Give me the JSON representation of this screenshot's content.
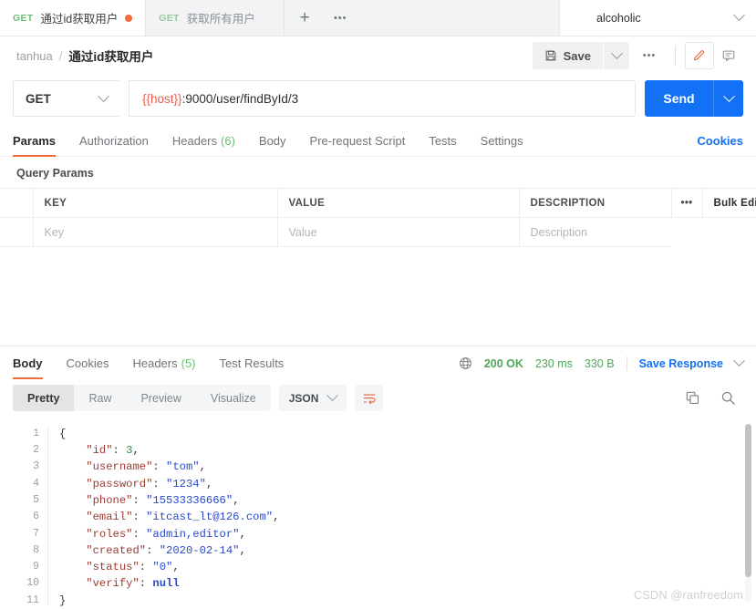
{
  "tabstrip": {
    "tabs": [
      {
        "method": "GET",
        "title": "通过id获取用户",
        "unsaved": true,
        "active": true
      },
      {
        "method": "GET",
        "title": "获取所有用户",
        "unsaved": false,
        "active": false
      }
    ],
    "new_tab_label": "+",
    "more_label": "•••",
    "environment": "alcoholic"
  },
  "header": {
    "breadcrumb_collection": "tanhua",
    "breadcrumb_separator": "/",
    "breadcrumb_request": "通过id获取用户",
    "save_label": "Save",
    "more_label": "•••"
  },
  "request": {
    "method": "GET",
    "url_variable": "{{host}}",
    "url_rest": ":9000/user/findById/3",
    "send_label": "Send",
    "tabs": [
      {
        "label": "Params",
        "count": "",
        "active": true
      },
      {
        "label": "Authorization",
        "count": "",
        "active": false
      },
      {
        "label": "Headers",
        "count": "(6)",
        "active": false
      },
      {
        "label": "Body",
        "count": "",
        "active": false
      },
      {
        "label": "Pre-request Script",
        "count": "",
        "active": false
      },
      {
        "label": "Tests",
        "count": "",
        "active": false
      },
      {
        "label": "Settings",
        "count": "",
        "active": false
      }
    ],
    "cookies_label": "Cookies"
  },
  "query_params": {
    "section_label": "Query Params",
    "columns": [
      "KEY",
      "VALUE",
      "DESCRIPTION"
    ],
    "dots_label": "•••",
    "bulk_edit_label": "Bulk Edit",
    "placeholder_row": {
      "key": "Key",
      "value": "Value",
      "description": "Description"
    }
  },
  "response": {
    "tabs": [
      {
        "label": "Body",
        "count": "",
        "active": true
      },
      {
        "label": "Cookies",
        "count": "",
        "active": false
      },
      {
        "label": "Headers",
        "count": "(5)",
        "active": false
      },
      {
        "label": "Test Results",
        "count": "",
        "active": false
      }
    ],
    "status_code": "200 OK",
    "time": "230 ms",
    "size": "330 B",
    "save_response_label": "Save Response",
    "view_modes": [
      {
        "label": "Pretty",
        "active": true
      },
      {
        "label": "Raw",
        "active": false
      },
      {
        "label": "Preview",
        "active": false
      },
      {
        "label": "Visualize",
        "active": false
      }
    ],
    "format": "JSON",
    "line_numbers": [
      "1",
      "2",
      "3",
      "4",
      "5",
      "6",
      "7",
      "8",
      "9",
      "10",
      "11"
    ],
    "body_json": {
      "id": 3,
      "username": "tom",
      "password": "1234",
      "phone": "15533336666",
      "email": "itcast_lt@126.com",
      "roles": "admin,editor",
      "created": "2020-02-14",
      "status": "0",
      "verify": null
    }
  },
  "watermark": "CSDN @ranfreedom",
  "colors": {
    "accent_orange": "#f26b3a",
    "send_blue": "#1271f5",
    "status_green": "#4fa65b",
    "method_green": "#6bbf73",
    "json_key": "#9c3b32",
    "json_string": "#2b4acb",
    "json_number": "#2f8f3f"
  }
}
